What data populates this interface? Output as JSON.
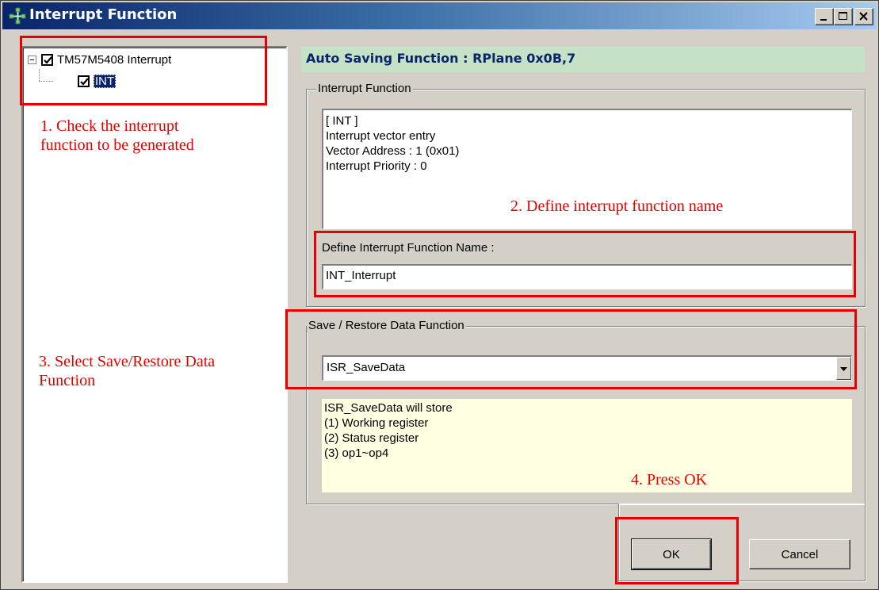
{
  "window": {
    "title": "Interrupt Function"
  },
  "tree": {
    "root_label": "TM57M5408 Interrupt",
    "child_label": "INT"
  },
  "auto_saving": {
    "text": "Auto Saving Function : RPlane 0x0B,7"
  },
  "interrupt_group": {
    "legend": "Interrupt Function",
    "info_lines": [
      "[ INT ]",
      "Interrupt vector entry",
      "Vector Address : 1 (0x01)",
      "Interrupt Priority : 0"
    ],
    "name_label": "Define Interrupt Function Name :",
    "name_value": "INT_Interrupt"
  },
  "save_group": {
    "legend": "Save / Restore Data Function",
    "selected": "ISR_SaveData",
    "desc_lines": [
      "ISR_SaveData will store",
      "(1) Working register",
      "(2) Status register",
      "(3) op1~op4"
    ]
  },
  "buttons": {
    "ok": "OK",
    "cancel": "Cancel"
  },
  "annotations": {
    "step1": [
      "1. Check the interrupt",
      "function to be generated"
    ],
    "step2": "2. Define interrupt function name",
    "step3": [
      "3. Select Save/Restore Data",
      "Function"
    ],
    "step4": "4. Press OK"
  },
  "colors": {
    "annotation": "#e60000",
    "title_bar": "#0a246a",
    "auto_saving_bg": "#c6e2c6",
    "description_bg": "#ffffe1"
  }
}
